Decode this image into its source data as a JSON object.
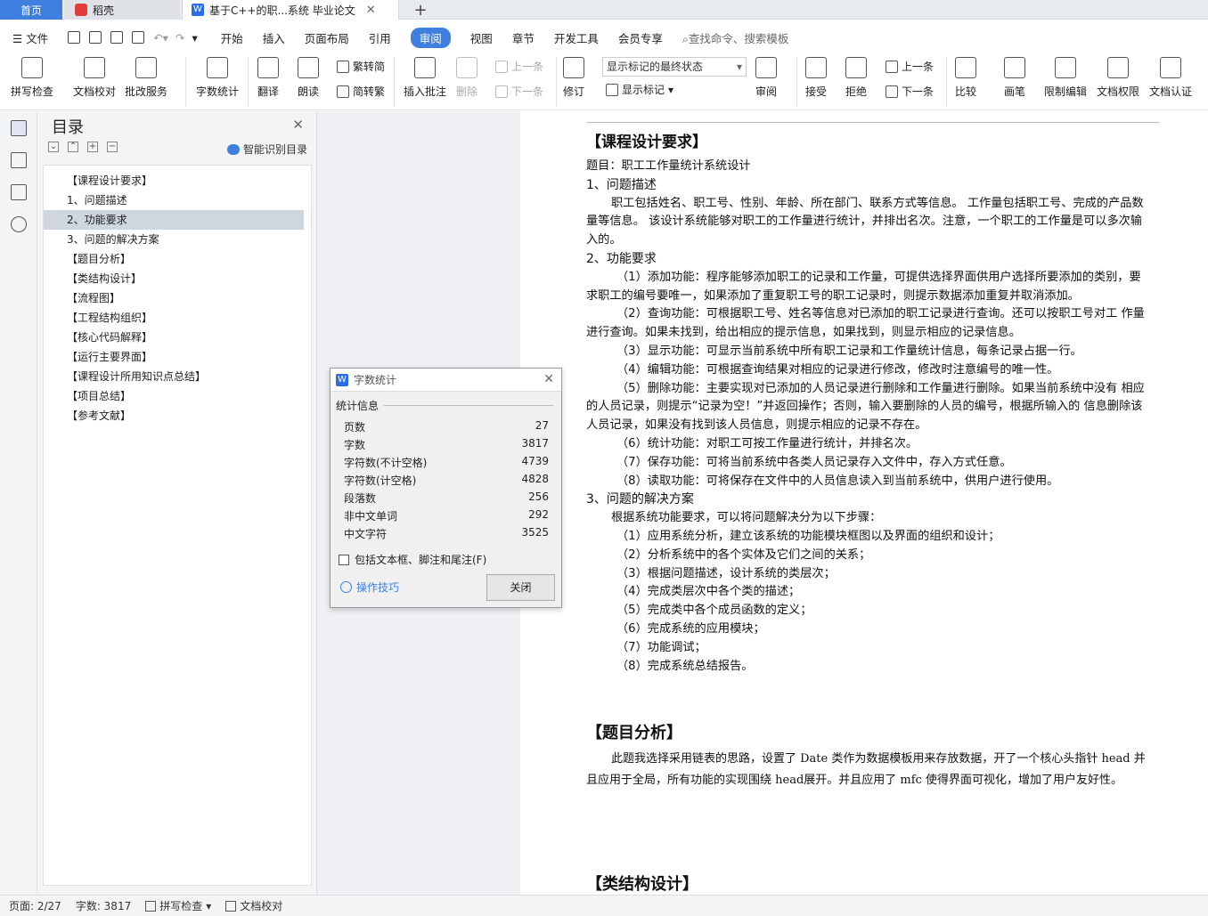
{
  "tabs": {
    "home": "首页",
    "daoke": "稻壳",
    "doc": "基于C++的职...系统 毕业论文"
  },
  "menu": {
    "file": "文件",
    "items": [
      "开始",
      "插入",
      "页面布局",
      "引用",
      "审阅",
      "视图",
      "章节",
      "开发工具",
      "会员专享"
    ],
    "active": "审阅",
    "search_placeholder": "查找命令、搜索模板"
  },
  "ribbon": {
    "spell": "拼写检查",
    "proof": "文档校对",
    "batch": "批改服务",
    "wordcount": "字数统计",
    "translate": "翻译",
    "read": "朗读",
    "trad": "繁转简",
    "simp": "简转繁",
    "insert_comment": "插入批注",
    "delete": "删除",
    "prev": "上一条",
    "next": "下一条",
    "revise": "修订",
    "show_final": "显示标记的最终状态",
    "show_markup": "显示标记",
    "review": "审阅",
    "accept": "接受",
    "reject": "拒绝",
    "prev2": "上一条",
    "next2": "下一条",
    "compare": "比较",
    "pen": "画笔",
    "restrict": "限制编辑",
    "perm": "文档权限",
    "cert": "文档认证"
  },
  "toc": {
    "title": "目录",
    "smart": "智能识别目录",
    "items": [
      {
        "label": "【课程设计要求】",
        "sub": false
      },
      {
        "label": "1、问题描述",
        "sub": true
      },
      {
        "label": "2、功能要求",
        "sub": true
      },
      {
        "label": "3、问题的解决方案",
        "sub": true
      },
      {
        "label": "【题目分析】",
        "sub": false
      },
      {
        "label": "【类结构设计】",
        "sub": false
      },
      {
        "label": "【流程图】",
        "sub": false
      },
      {
        "label": "【工程结构组织】",
        "sub": false
      },
      {
        "label": "【核心代码解释】",
        "sub": false
      },
      {
        "label": "【运行主要界面】",
        "sub": false
      },
      {
        "label": "【课程设计所用知识点总结】",
        "sub": false
      },
      {
        "label": "【项目总结】",
        "sub": false
      },
      {
        "label": "【参考文献】",
        "sub": false
      }
    ]
  },
  "document": {
    "h1": "【课程设计要求】",
    "topic": "题目：职工工作量统计系统设计",
    "s1": "1、问题描述",
    "p1": "职工包括姓名、职工号、性别、年龄、所在部门、联系方式等信息。 工作量包括职工号、完成的产品数量等信息。 该设计系统能够对职工的工作量进行统计，并排出名次。注意，一个职工的工作量是可以多次输入的。",
    "s2": "2、功能要求",
    "f1": "（1）添加功能：程序能够添加职工的记录和工作量，可提供选择界面供用户选择所要添加的类别，要求职工的编号要唯一，如果添加了重复职工号的职工记录时，则提示数据添加重复并取消添加。",
    "f2": "（2）查询功能：可根据职工号、姓名等信息对已添加的职工记录进行查询。还可以按职工号对工 作量进行查询。如果未找到，给出相应的提示信息，如果找到，则显示相应的记录信息。",
    "f3": "（3）显示功能：可显示当前系统中所有职工记录和工作量统计信息，每条记录占据一行。",
    "f4": "（4）编辑功能：可根据查询结果对相应的记录进行修改，修改时注意编号的唯一性。",
    "f5": "（5）删除功能：主要实现对已添加的人员记录进行删除和工作量进行删除。如果当前系统中没有 相应的人员记录，则提示“记录为空！”并返回操作；否则，输入要删除的人员的编号，根据所输入的 信息删除该人员记录，如果没有找到该人员信息，则提示相应的记录不存在。",
    "f6": "（6）统计功能：对职工可按工作量进行统计，并排名次。",
    "f7": "（7）保存功能：可将当前系统中各类人员记录存入文件中，存入方式任意。",
    "f8": "（8）读取功能：可将保存在文件中的人员信息读入到当前系统中，供用户进行使用。",
    "s3": "3、问题的解决方案",
    "intro": "根据系统功能要求，可以将问题解决分为以下步骤：",
    "steps": [
      "（1）应用系统分析，建立该系统的功能模块框图以及界面的组织和设计；",
      "（2）分析系统中的各个实体及它们之间的关系；",
      "（3）根据问题描述，设计系统的类层次；",
      "（4）完成类层次中各个类的描述；",
      "（5）完成类中各个成员函数的定义；",
      "（6）完成系统的应用模块；",
      "（7）功能调试；",
      "（8）完成系统总结报告。"
    ],
    "h2": "【题目分析】",
    "analysis": "此题我选择采用链表的思路，设置了 Date 类作为数据模板用来存放数据，开了一个核心头指针 head 并且应用于全局，所有功能的实现围绕 head展开。并且应用了 mfc 使得界面可视化，增加了用户友好性。",
    "h3_partial": "【类结构设计】"
  },
  "dialog": {
    "title": "字数统计",
    "section": "统计信息",
    "rows": [
      {
        "label": "页数",
        "value": "27"
      },
      {
        "label": "字数",
        "value": "3817"
      },
      {
        "label": "字符数(不计空格)",
        "value": "4739"
      },
      {
        "label": "字符数(计空格)",
        "value": "4828"
      },
      {
        "label": "段落数",
        "value": "256"
      },
      {
        "label": "非中文单词",
        "value": "292"
      },
      {
        "label": "中文字符",
        "value": "3525"
      }
    ],
    "include": "包括文本框、脚注和尾注(F)",
    "tips": "操作技巧",
    "close": "关闭"
  },
  "status": {
    "page": "页面: 2/27",
    "words": "字数: 3817",
    "spell": "拼写检查",
    "proof": "文档校对"
  }
}
